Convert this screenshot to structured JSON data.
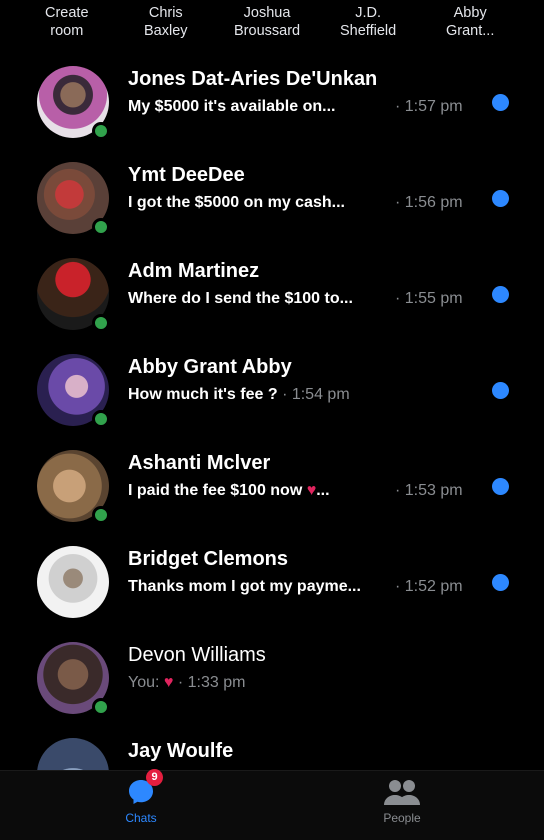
{
  "stories": [
    {
      "line1": "Create",
      "line2": "room"
    },
    {
      "line1": "Chris",
      "line2": "Baxley"
    },
    {
      "line1": "Joshua",
      "line2": "Broussard"
    },
    {
      "line1": "J.D.",
      "line2": "Sheffield"
    },
    {
      "line1": "Abby",
      "line2": "Grant..."
    }
  ],
  "chats": [
    {
      "name": "Jones Dat-Aries De'Unkan",
      "preview": "My $5000 it's available on...",
      "time": "· 1:57 pm",
      "unread": true
    },
    {
      "name": "Ymt DeeDee",
      "preview": "I got the $5000 on my cash...",
      "time": "· 1:56 pm",
      "unread": true
    },
    {
      "name": "Adm Martinez",
      "preview": "Where do I send the $100 to...",
      "time": "· 1:55 pm",
      "unread": true
    },
    {
      "name": "Abby Grant Abby",
      "preview": "How much it's fee ?",
      "time": "· 1:54 pm",
      "unread": true
    },
    {
      "name": "Ashanti Mclver",
      "preview": "I paid the fee  $100 now",
      "preview_suffix": "...",
      "time": "· 1:53 pm",
      "unread": true
    },
    {
      "name": "Bridget Clemons",
      "preview": "Thanks mom I got my payme...",
      "time": "· 1:52 pm",
      "unread": true
    },
    {
      "name": "Devon Williams",
      "preview": "You:",
      "time": "· 1:33 pm",
      "unread": false
    },
    {
      "name": "Jay Woulfe",
      "preview": "",
      "time": "",
      "unread": false
    }
  ],
  "tabs": {
    "chats": {
      "label": "Chats",
      "badge": "9",
      "icon": "chat-bubble-icon"
    },
    "people": {
      "label": "People",
      "icon": "people-icon"
    }
  },
  "colors": {
    "accent": "#2d88ff",
    "presence": "#31a24c",
    "badge": "#e41e3f",
    "muted": "#8a8d91"
  }
}
